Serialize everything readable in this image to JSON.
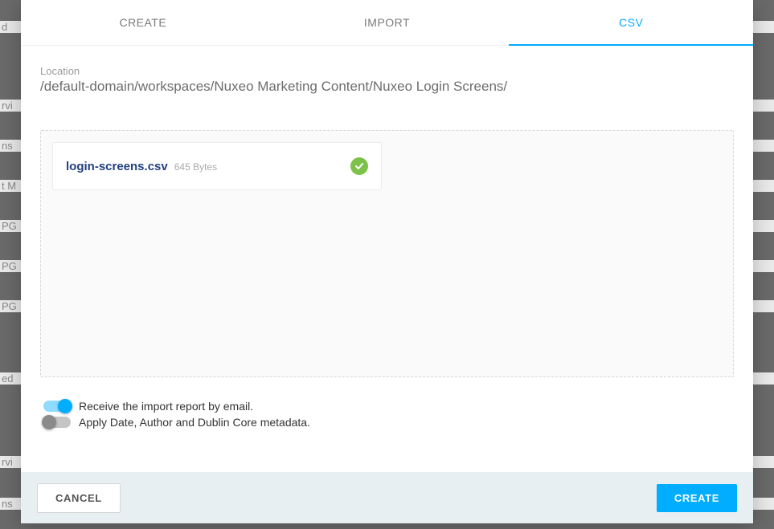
{
  "tabs": {
    "create": "CREATE",
    "import": "IMPORT",
    "csv": "CSV"
  },
  "location": {
    "label": "Location",
    "path": "/default-domain/workspaces/Nuxeo Marketing Content/Nuxeo Login Screens/"
  },
  "file": {
    "name": "login-screens.csv",
    "size": "645 Bytes"
  },
  "options": {
    "email_report": {
      "label": "Receive the import report by email.",
      "value": true
    },
    "apply_metadata": {
      "label": "Apply Date, Author and Dublin Core metadata.",
      "value": false
    }
  },
  "footer": {
    "cancel": "CANCEL",
    "create": "CREATE"
  },
  "background_items": [
    "d",
    "rvi",
    "ns",
    "t M",
    "PG",
    "PG",
    "PG",
    "ed",
    "rvi",
    "ns"
  ]
}
